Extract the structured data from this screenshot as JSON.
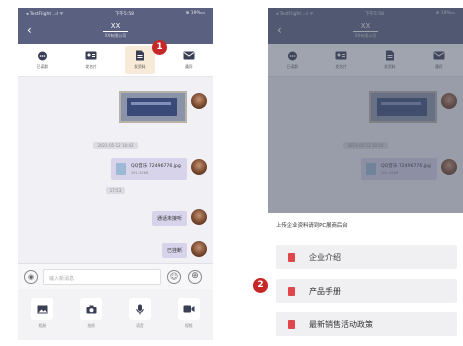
{
  "left": {
    "status": {
      "carrier": "◂ TestFlight ..ıl ᯤ",
      "time": "下午5:58",
      "battery": "⊕ 19%▭"
    },
    "nav": {
      "back": "‹",
      "title": "XX",
      "subtitle": "XX有限公司"
    },
    "toolbar": [
      {
        "label": "已读群",
        "icon": "chat-icon"
      },
      {
        "label": "发名片",
        "icon": "card-icon"
      },
      {
        "label": "发资料",
        "icon": "doc-icon"
      },
      {
        "label": "通问",
        "icon": "mail-icon"
      }
    ],
    "chat": {
      "timestamp1": "2021-05-12 10:42",
      "file_name": "QQ音乐 72496776.jpg",
      "file_size": "261.45KB",
      "timestamp2": "17:53",
      "msg1": "通话未接听",
      "msg2": "已挂断"
    },
    "input": {
      "placeholder": "输入新消息"
    },
    "actions": [
      {
        "label": "相册",
        "icon": "photo-icon"
      },
      {
        "label": "拍照",
        "icon": "camera-icon"
      },
      {
        "label": "语音",
        "icon": "microphone-icon"
      },
      {
        "label": "视频",
        "icon": "video-icon"
      }
    ]
  },
  "right": {
    "status": {
      "carrier": "◂ TestFlight ..ıl ᯤ",
      "time": "下午5:58",
      "battery": "⊕ 19%▭"
    },
    "nav": {
      "back": "‹",
      "title": "XX",
      "subtitle": "XX有限公司"
    },
    "toolbar": [
      {
        "label": "已读群",
        "icon": "chat-icon"
      },
      {
        "label": "发名片",
        "icon": "card-icon"
      },
      {
        "label": "发资料",
        "icon": "doc-icon"
      },
      {
        "label": "通问",
        "icon": "mail-icon"
      }
    ],
    "chat": {
      "timestamp1": "2021-05-12 10:42",
      "file_name": "QQ音乐 72496776.jpg",
      "file_size": "261.45KB"
    },
    "sheet": {
      "title": "上传企业资料请到PC展商后台",
      "options": [
        "企业介绍",
        "产品手册",
        "最新销售活动政策"
      ]
    }
  },
  "markers": {
    "one": "1",
    "two": "2"
  },
  "colors": {
    "nav": "#5a607f",
    "bubble": "#d7d3ea",
    "marker": "#c62828",
    "file_icon": "#e0474c"
  }
}
